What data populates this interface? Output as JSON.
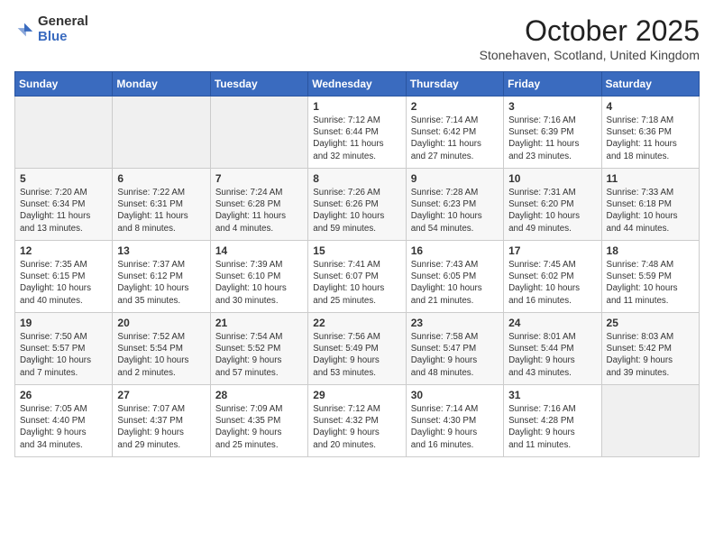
{
  "logo": {
    "text_general": "General",
    "text_blue": "Blue"
  },
  "title": "October 2025",
  "location": "Stonehaven, Scotland, United Kingdom",
  "days_of_week": [
    "Sunday",
    "Monday",
    "Tuesday",
    "Wednesday",
    "Thursday",
    "Friday",
    "Saturday"
  ],
  "weeks": [
    [
      {
        "day": "",
        "info": ""
      },
      {
        "day": "",
        "info": ""
      },
      {
        "day": "",
        "info": ""
      },
      {
        "day": "1",
        "info": "Sunrise: 7:12 AM\nSunset: 6:44 PM\nDaylight: 11 hours\nand 32 minutes."
      },
      {
        "day": "2",
        "info": "Sunrise: 7:14 AM\nSunset: 6:42 PM\nDaylight: 11 hours\nand 27 minutes."
      },
      {
        "day": "3",
        "info": "Sunrise: 7:16 AM\nSunset: 6:39 PM\nDaylight: 11 hours\nand 23 minutes."
      },
      {
        "day": "4",
        "info": "Sunrise: 7:18 AM\nSunset: 6:36 PM\nDaylight: 11 hours\nand 18 minutes."
      }
    ],
    [
      {
        "day": "5",
        "info": "Sunrise: 7:20 AM\nSunset: 6:34 PM\nDaylight: 11 hours\nand 13 minutes."
      },
      {
        "day": "6",
        "info": "Sunrise: 7:22 AM\nSunset: 6:31 PM\nDaylight: 11 hours\nand 8 minutes."
      },
      {
        "day": "7",
        "info": "Sunrise: 7:24 AM\nSunset: 6:28 PM\nDaylight: 11 hours\nand 4 minutes."
      },
      {
        "day": "8",
        "info": "Sunrise: 7:26 AM\nSunset: 6:26 PM\nDaylight: 10 hours\nand 59 minutes."
      },
      {
        "day": "9",
        "info": "Sunrise: 7:28 AM\nSunset: 6:23 PM\nDaylight: 10 hours\nand 54 minutes."
      },
      {
        "day": "10",
        "info": "Sunrise: 7:31 AM\nSunset: 6:20 PM\nDaylight: 10 hours\nand 49 minutes."
      },
      {
        "day": "11",
        "info": "Sunrise: 7:33 AM\nSunset: 6:18 PM\nDaylight: 10 hours\nand 44 minutes."
      }
    ],
    [
      {
        "day": "12",
        "info": "Sunrise: 7:35 AM\nSunset: 6:15 PM\nDaylight: 10 hours\nand 40 minutes."
      },
      {
        "day": "13",
        "info": "Sunrise: 7:37 AM\nSunset: 6:12 PM\nDaylight: 10 hours\nand 35 minutes."
      },
      {
        "day": "14",
        "info": "Sunrise: 7:39 AM\nSunset: 6:10 PM\nDaylight: 10 hours\nand 30 minutes."
      },
      {
        "day": "15",
        "info": "Sunrise: 7:41 AM\nSunset: 6:07 PM\nDaylight: 10 hours\nand 25 minutes."
      },
      {
        "day": "16",
        "info": "Sunrise: 7:43 AM\nSunset: 6:05 PM\nDaylight: 10 hours\nand 21 minutes."
      },
      {
        "day": "17",
        "info": "Sunrise: 7:45 AM\nSunset: 6:02 PM\nDaylight: 10 hours\nand 16 minutes."
      },
      {
        "day": "18",
        "info": "Sunrise: 7:48 AM\nSunset: 5:59 PM\nDaylight: 10 hours\nand 11 minutes."
      }
    ],
    [
      {
        "day": "19",
        "info": "Sunrise: 7:50 AM\nSunset: 5:57 PM\nDaylight: 10 hours\nand 7 minutes."
      },
      {
        "day": "20",
        "info": "Sunrise: 7:52 AM\nSunset: 5:54 PM\nDaylight: 10 hours\nand 2 minutes."
      },
      {
        "day": "21",
        "info": "Sunrise: 7:54 AM\nSunset: 5:52 PM\nDaylight: 9 hours\nand 57 minutes."
      },
      {
        "day": "22",
        "info": "Sunrise: 7:56 AM\nSunset: 5:49 PM\nDaylight: 9 hours\nand 53 minutes."
      },
      {
        "day": "23",
        "info": "Sunrise: 7:58 AM\nSunset: 5:47 PM\nDaylight: 9 hours\nand 48 minutes."
      },
      {
        "day": "24",
        "info": "Sunrise: 8:01 AM\nSunset: 5:44 PM\nDaylight: 9 hours\nand 43 minutes."
      },
      {
        "day": "25",
        "info": "Sunrise: 8:03 AM\nSunset: 5:42 PM\nDaylight: 9 hours\nand 39 minutes."
      }
    ],
    [
      {
        "day": "26",
        "info": "Sunrise: 7:05 AM\nSunset: 4:40 PM\nDaylight: 9 hours\nand 34 minutes."
      },
      {
        "day": "27",
        "info": "Sunrise: 7:07 AM\nSunset: 4:37 PM\nDaylight: 9 hours\nand 29 minutes."
      },
      {
        "day": "28",
        "info": "Sunrise: 7:09 AM\nSunset: 4:35 PM\nDaylight: 9 hours\nand 25 minutes."
      },
      {
        "day": "29",
        "info": "Sunrise: 7:12 AM\nSunset: 4:32 PM\nDaylight: 9 hours\nand 20 minutes."
      },
      {
        "day": "30",
        "info": "Sunrise: 7:14 AM\nSunset: 4:30 PM\nDaylight: 9 hours\nand 16 minutes."
      },
      {
        "day": "31",
        "info": "Sunrise: 7:16 AM\nSunset: 4:28 PM\nDaylight: 9 hours\nand 11 minutes."
      },
      {
        "day": "",
        "info": ""
      }
    ]
  ]
}
